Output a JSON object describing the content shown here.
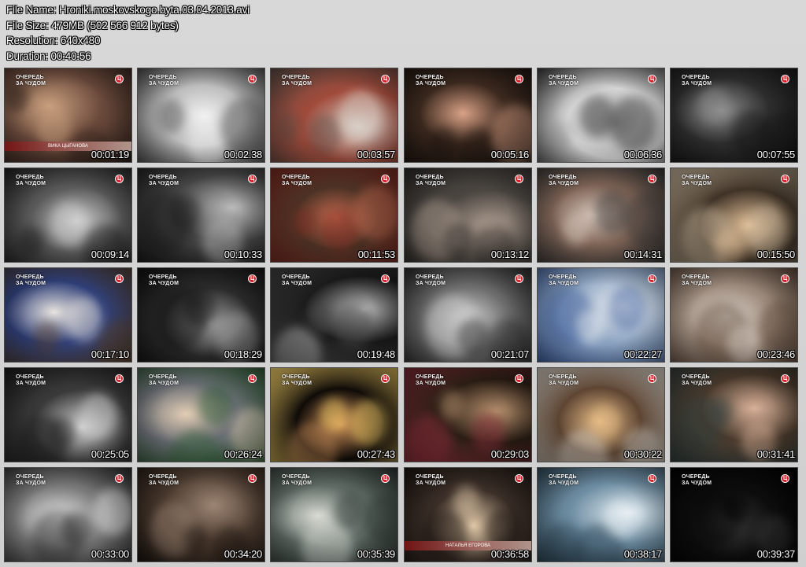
{
  "info": {
    "file_name": "File Name: Hroniki.moskovskogo.byta.03.04.2013.avi",
    "file_size": "File Size: 479MB (502 566 912 bytes)",
    "resolution": "Resolution: 640x480",
    "duration": "Duration: 00:40:56"
  },
  "logo_line1": "ОЧЕРЕДЬ",
  "logo_line2": "ЗА ЧУДОМ",
  "channel_mark": "Ц",
  "thumbnails": [
    {
      "time": "00:01:19",
      "caption": "ВИКА ЦЫГАНОВА",
      "bg": [
        "#6b4a3c",
        "#c9a07e",
        "#2a1d17"
      ]
    },
    {
      "time": "00:02:38",
      "bg": [
        "#bdbdbd",
        "#f2f2f2",
        "#4a4a4a"
      ]
    },
    {
      "time": "00:03:57",
      "bg": [
        "#a04a3a",
        "#d8d0c8",
        "#5b4b44"
      ]
    },
    {
      "time": "00:05:16",
      "bg": [
        "#3d2a1f",
        "#d9a186",
        "#1b130f"
      ]
    },
    {
      "time": "00:06:36",
      "bg": [
        "#d4d4d4",
        "#9a9a9a",
        "#3a3a3a"
      ]
    },
    {
      "time": "00:07:55",
      "bg": [
        "#2d2d2d",
        "#8e8e8e",
        "#141414"
      ]
    },
    {
      "time": "00:09:14",
      "bg": [
        "#5a5a5a",
        "#cfcfcf",
        "#1d1d1d"
      ]
    },
    {
      "time": "00:10:33",
      "bg": [
        "#474747",
        "#bababa",
        "#1a1a1a"
      ]
    },
    {
      "time": "00:11:53",
      "bg": [
        "#4b3124",
        "#c46a4f",
        "#7c2b22"
      ]
    },
    {
      "time": "00:13:12",
      "bg": [
        "#4b4641",
        "#b7a597",
        "#2b2826"
      ]
    },
    {
      "time": "00:14:31",
      "bg": [
        "#7d6355",
        "#d8c7bc",
        "#343434"
      ]
    },
    {
      "time": "00:15:50",
      "bg": [
        "#3f3327",
        "#e6c39a",
        "#c7b59b"
      ]
    },
    {
      "time": "00:17:10",
      "bg": [
        "#2f3f78",
        "#e8e4df",
        "#56402e"
      ]
    },
    {
      "time": "00:18:29",
      "bg": [
        "#2c2c2c",
        "#a6a6a6",
        "#101010"
      ]
    },
    {
      "time": "00:19:48",
      "bg": [
        "#1b1b1b",
        "#b8b8b8",
        "#4a4a4a"
      ]
    },
    {
      "time": "00:21:07",
      "bg": [
        "#6d6d6d",
        "#d2d2d2",
        "#2a2a2a"
      ]
    },
    {
      "time": "00:22:27",
      "bg": [
        "#8fa6c2",
        "#eceff3",
        "#3e5d9a"
      ]
    },
    {
      "time": "00:23:46",
      "bg": [
        "#9d8b7d",
        "#e0d6cd",
        "#5b4638"
      ]
    },
    {
      "time": "00:25:05",
      "bg": [
        "#3a3a3a",
        "#d2d2d2",
        "#1a1a1a"
      ]
    },
    {
      "time": "00:26:24",
      "bg": [
        "#6a6e74",
        "#e2cdb4",
        "#2c5a31"
      ]
    },
    {
      "time": "00:27:43",
      "bg": [
        "#0f0b08",
        "#c58a56",
        "#ffd86b"
      ]
    },
    {
      "time": "00:29:03",
      "bg": [
        "#2a1d14",
        "#b48f6c",
        "#8a2e3a"
      ]
    },
    {
      "time": "00:30:22",
      "bg": [
        "#5e4533",
        "#e5bb85",
        "#d7d2c8"
      ]
    },
    {
      "time": "00:31:41",
      "bg": [
        "#4a3a2c",
        "#d9b199",
        "#2f3e3d"
      ]
    },
    {
      "time": "00:33:00",
      "bg": [
        "#7a7a7a",
        "#e9e9e9",
        "#2a2a2a"
      ]
    },
    {
      "time": "00:34:20",
      "bg": [
        "#4c3b2f",
        "#9c8574",
        "#1c1510"
      ]
    },
    {
      "time": "00:35:39",
      "bg": [
        "#5f6b64",
        "#d8dbd4",
        "#2b3430"
      ]
    },
    {
      "time": "00:36:58",
      "caption": "НАТАЛЬЯ ЕГОРОВА",
      "bg": [
        "#3b2f28",
        "#e1c9a8",
        "#1b1410"
      ]
    },
    {
      "time": "00:38:17",
      "bg": [
        "#6e8ea3",
        "#e6eef2",
        "#2d4453"
      ]
    },
    {
      "time": "00:39:37",
      "bg": [
        "#0d0d0d",
        "#3a3a3a",
        "#000000"
      ]
    }
  ]
}
